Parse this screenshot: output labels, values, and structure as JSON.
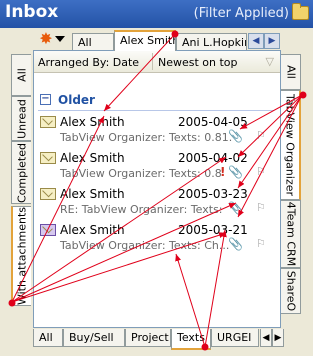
{
  "header": {
    "title": "Inbox",
    "filter_status": "(Filter Applied)",
    "icon": "folder-icon"
  },
  "top_tabs": {
    "items": [
      "All",
      "Alex Smith",
      "Ani L.Hopkins"
    ],
    "active": "Alex Smith",
    "new_item_icon": "star-icon",
    "nav": [
      "◀",
      "▶"
    ]
  },
  "left_tabs": {
    "items": [
      "All",
      "Unread",
      "Completed",
      "With attachments"
    ],
    "active": "With attachments"
  },
  "right_tabs": {
    "items": [
      "All",
      "TabView Organizer",
      "4Team CRM",
      "ShareO"
    ],
    "active": "TabView Organizer"
  },
  "columns": {
    "arranged_by": "Arranged By: Date",
    "sort": "Newest on top",
    "filter_icon": "funnel-icon"
  },
  "group": {
    "toggle": "−",
    "label": "Older"
  },
  "messages": [
    {
      "from": "Alex Smith",
      "date": "2005-04-05",
      "subject": "TabView Organizer: Texts: 0.81.",
      "attachment": true,
      "important": false,
      "icon": "envelope-icon"
    },
    {
      "from": "Alex Smith",
      "date": "2005-04-02",
      "subject": "TabView Organizer: Texts: 0.8",
      "attachment": true,
      "important": true,
      "icon": "envelope-icon"
    },
    {
      "from": "Alex Smith",
      "date": "2005-03-23",
      "subject": "RE: TabView Organizer: Texts:",
      "attachment": true,
      "important": false,
      "icon": "envelope-icon"
    },
    {
      "from": "Alex Smith",
      "date": "2005-03-21",
      "subject": "TabView Organizer: Texts: Ch...",
      "attachment": true,
      "important": false,
      "icon": "envelope-forward-icon"
    }
  ],
  "bottom_tabs": {
    "items": [
      "All",
      "Buy/Sell",
      "Project",
      "Texts",
      "URGEI"
    ],
    "active": "Texts",
    "nav": [
      "◀",
      "▶"
    ]
  },
  "symbols": {
    "important": "!",
    "attachment": "📎",
    "flag": "⚐"
  },
  "colors": {
    "header": "#2e5cb0",
    "accent_tab": "#e3a33b",
    "group_label": "#2152a3",
    "annotation": "#e0001a"
  }
}
